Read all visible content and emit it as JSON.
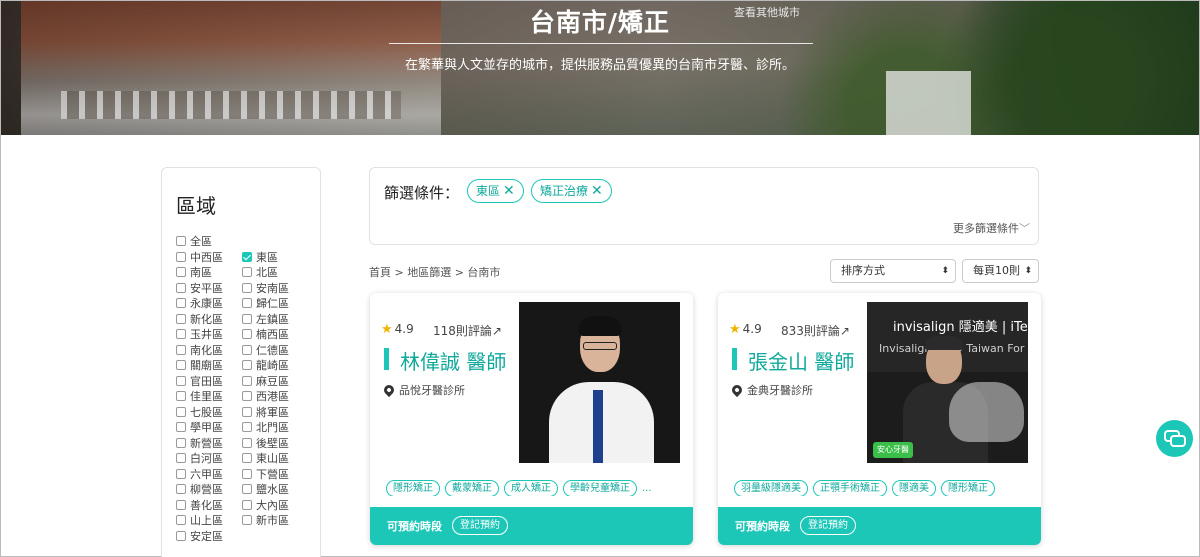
{
  "hero": {
    "title": "台南市/矯正",
    "other_city_link": "查看其他城市",
    "subtitle": "在繁華與人文並存的城市，提供服務品質優異的台南市牙醫、診所。"
  },
  "sidebar": {
    "title": "區域",
    "districts": [
      {
        "label": "全區",
        "checked": false
      },
      {
        "label": "中西區",
        "checked": false
      },
      {
        "label": "東區",
        "checked": true
      },
      {
        "label": "南區",
        "checked": false
      },
      {
        "label": "北區",
        "checked": false
      },
      {
        "label": "安平區",
        "checked": false
      },
      {
        "label": "安南區",
        "checked": false
      },
      {
        "label": "永康區",
        "checked": false
      },
      {
        "label": "歸仁區",
        "checked": false
      },
      {
        "label": "新化區",
        "checked": false
      },
      {
        "label": "左鎮區",
        "checked": false
      },
      {
        "label": "玉井區",
        "checked": false
      },
      {
        "label": "楠西區",
        "checked": false
      },
      {
        "label": "南化區",
        "checked": false
      },
      {
        "label": "仁德區",
        "checked": false
      },
      {
        "label": "關廟區",
        "checked": false
      },
      {
        "label": "龍崎區",
        "checked": false
      },
      {
        "label": "官田區",
        "checked": false
      },
      {
        "label": "麻豆區",
        "checked": false
      },
      {
        "label": "佳里區",
        "checked": false
      },
      {
        "label": "西港區",
        "checked": false
      },
      {
        "label": "七股區",
        "checked": false
      },
      {
        "label": "將軍區",
        "checked": false
      },
      {
        "label": "學甲區",
        "checked": false
      },
      {
        "label": "北門區",
        "checked": false
      },
      {
        "label": "新營區",
        "checked": false
      },
      {
        "label": "後壁區",
        "checked": false
      },
      {
        "label": "白河區",
        "checked": false
      },
      {
        "label": "東山區",
        "checked": false
      },
      {
        "label": "六甲區",
        "checked": false
      },
      {
        "label": "下營區",
        "checked": false
      },
      {
        "label": "柳營區",
        "checked": false
      },
      {
        "label": "鹽水區",
        "checked": false
      },
      {
        "label": "善化區",
        "checked": false
      },
      {
        "label": "大內區",
        "checked": false
      },
      {
        "label": "山上區",
        "checked": false
      },
      {
        "label": "新市區",
        "checked": false
      },
      {
        "label": "安定區",
        "checked": false
      }
    ]
  },
  "filter": {
    "label": "篩選條件：",
    "chips": [
      "東區",
      "矯正治療"
    ],
    "chip_remove_glyph": "✕",
    "more_label": "更多篩選條件",
    "more_glyph": "﹀"
  },
  "breadcrumb": "首頁 > 地區篩選 > 台南市",
  "sort": {
    "label": "排序方式",
    "glyph": "⬍"
  },
  "per_page": {
    "label": "每頁10則",
    "glyph": "⬍"
  },
  "cards": [
    {
      "rating": "4.9",
      "reviews": "118則評論↗",
      "name": "林偉誠 醫師",
      "clinic": "品悅牙醫診所",
      "tags": [
        "隱形矯正",
        "戴蒙矯正",
        "成人矯正",
        "學齡兒童矯正"
      ],
      "tags_more": "...",
      "available_label": "可預約時段",
      "book_label": "登記預約"
    },
    {
      "rating": "4.9",
      "reviews": "833則評論↗",
      "name": "張金山 醫師",
      "clinic": "金典牙醫診所",
      "tags": [
        "羽量級隱適美",
        "正顎手術矯正",
        "隱適美",
        "隱形矯正"
      ],
      "tags_more": "",
      "available_label": "可預約時段",
      "book_label": "登記預約",
      "photo_brand": "invisalign 隱適美 | iTe",
      "photo_event": "Invisalign 2019 Taiwan For",
      "photo_badge": "安心牙醫"
    }
  ],
  "colors": {
    "accent": "#1dc7b8",
    "accent_text": "#11a99c",
    "star": "#f0b400"
  }
}
